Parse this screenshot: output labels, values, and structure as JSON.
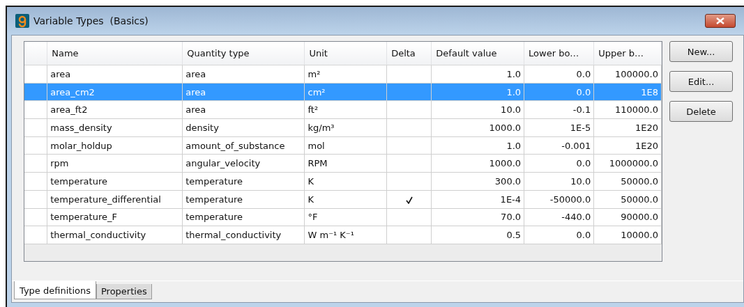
{
  "window": {
    "title": "Variable Types  (Basics)"
  },
  "table": {
    "columns": [
      "Name",
      "Quantity type",
      "Unit",
      "Delta",
      "Default value",
      "Lower bo…",
      "Upper b…"
    ],
    "rows": [
      {
        "name": "area",
        "quantity_type": "area",
        "unit": "m²",
        "delta": false,
        "default_value": "1.0",
        "lower_bound": "0.0",
        "upper_bound": "100000.0",
        "selected": false
      },
      {
        "name": "area_cm2",
        "quantity_type": "area",
        "unit": "cm²",
        "delta": false,
        "default_value": "1.0",
        "lower_bound": "0.0",
        "upper_bound": "1E8",
        "selected": true
      },
      {
        "name": "area_ft2",
        "quantity_type": "area",
        "unit": "ft²",
        "delta": false,
        "default_value": "10.0",
        "lower_bound": "-0.1",
        "upper_bound": "110000.0",
        "selected": false
      },
      {
        "name": "mass_density",
        "quantity_type": "density",
        "unit": "kg/m³",
        "delta": false,
        "default_value": "1000.0",
        "lower_bound": "1E-5",
        "upper_bound": "1E20",
        "selected": false
      },
      {
        "name": "molar_holdup",
        "quantity_type": "amount_of_substance",
        "unit": "mol",
        "delta": false,
        "default_value": "1.0",
        "lower_bound": "-0.001",
        "upper_bound": "1E20",
        "selected": false
      },
      {
        "name": "rpm",
        "quantity_type": "angular_velocity",
        "unit": "RPM",
        "delta": false,
        "default_value": "1000.0",
        "lower_bound": "0.0",
        "upper_bound": "1000000.0",
        "selected": false
      },
      {
        "name": "temperature",
        "quantity_type": "temperature",
        "unit": "K",
        "delta": false,
        "default_value": "300.0",
        "lower_bound": "10.0",
        "upper_bound": "50000.0",
        "selected": false
      },
      {
        "name": "temperature_differential",
        "quantity_type": "temperature",
        "unit": "K",
        "delta": true,
        "default_value": "1E-4",
        "lower_bound": "-50000.0",
        "upper_bound": "50000.0",
        "selected": false
      },
      {
        "name": "temperature_F",
        "quantity_type": "temperature",
        "unit": "°F",
        "delta": false,
        "default_value": "70.0",
        "lower_bound": "-440.0",
        "upper_bound": "90000.0",
        "selected": false
      },
      {
        "name": "thermal_conductivity",
        "quantity_type": "thermal_conductivity",
        "unit": "W m⁻¹ K⁻¹",
        "delta": false,
        "default_value": "0.5",
        "lower_bound": "0.0",
        "upper_bound": "10000.0",
        "selected": false
      }
    ]
  },
  "buttons": [
    "New...",
    "Edit...",
    "Delete"
  ],
  "tabs": [
    {
      "label": "Type definitions",
      "selected": true
    },
    {
      "label": "Properties",
      "selected": false
    }
  ]
}
